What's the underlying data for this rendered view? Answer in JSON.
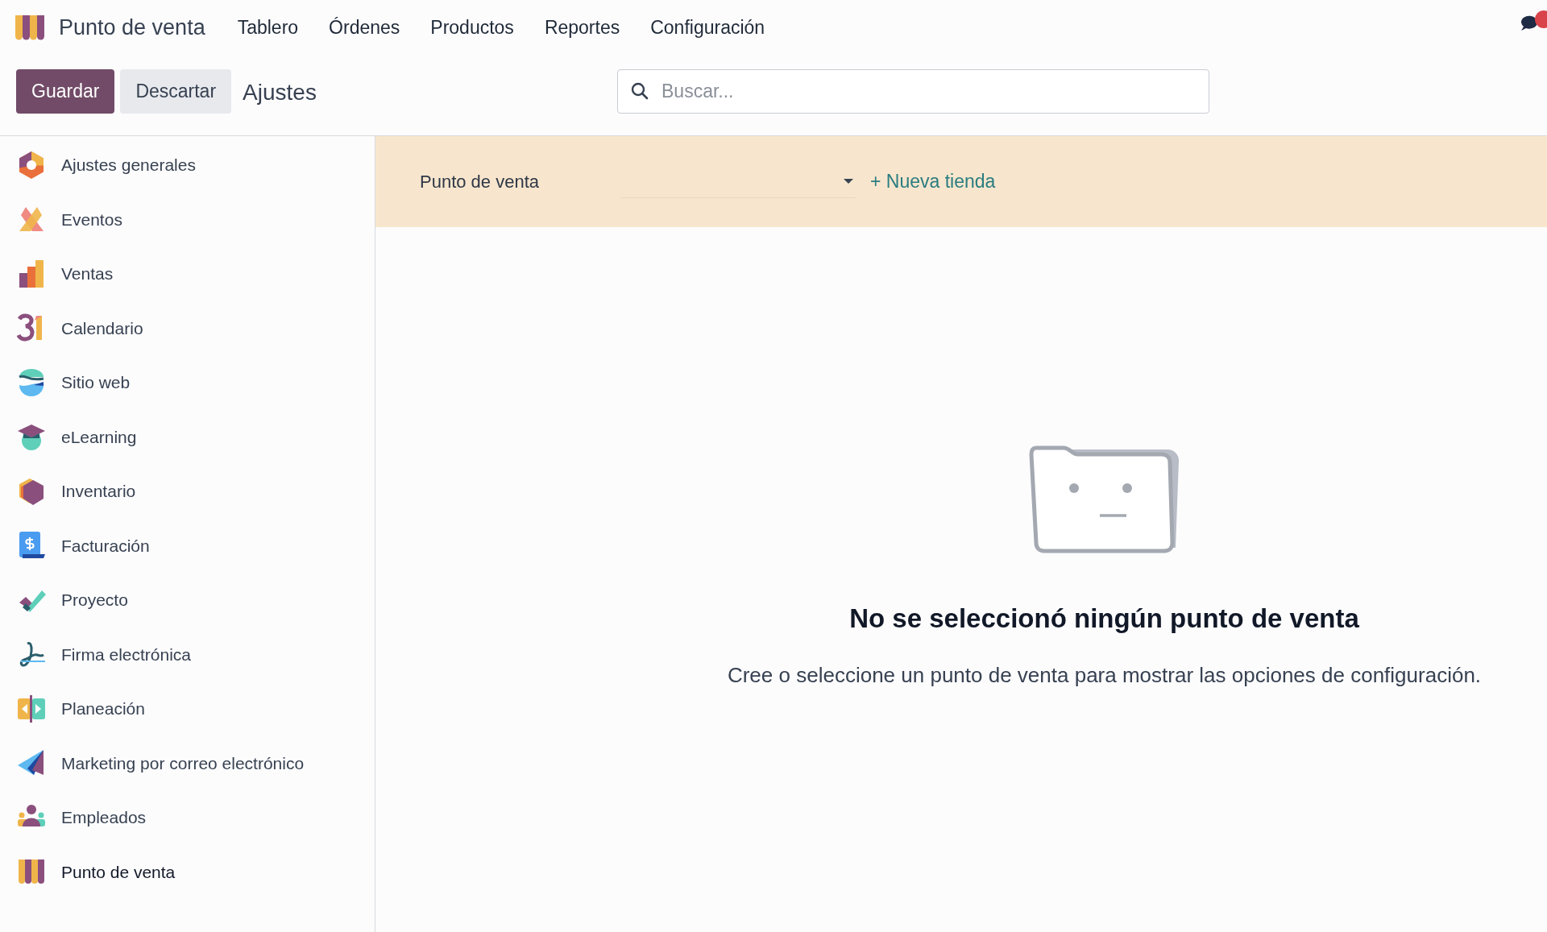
{
  "navbar": {
    "app_name": "Punto de venta",
    "menu": [
      "Tablero",
      "Órdenes",
      "Productos",
      "Reportes",
      "Configuración"
    ]
  },
  "control_panel": {
    "buttons": [
      {
        "label": "Guardar",
        "kind": "primary"
      },
      {
        "label": "Descartar",
        "kind": "secondary"
      }
    ],
    "breadcrumb": "Ajustes",
    "search": {
      "placeholder": "Buscar..."
    }
  },
  "sidebar": {
    "items": [
      {
        "label": "Ajustes generales",
        "selected": false
      },
      {
        "label": "Eventos",
        "selected": false
      },
      {
        "label": "Ventas",
        "selected": false
      },
      {
        "label": "Calendario",
        "selected": false
      },
      {
        "label": "Sitio web",
        "selected": false
      },
      {
        "label": "eLearning",
        "selected": false
      },
      {
        "label": "Inventario",
        "selected": false
      },
      {
        "label": "Facturación",
        "selected": false
      },
      {
        "label": "Proyecto",
        "selected": false
      },
      {
        "label": "Firma electrónica",
        "selected": false
      },
      {
        "label": "Planeación",
        "selected": false
      },
      {
        "label": "Marketing por correo electrónico",
        "selected": false
      },
      {
        "label": "Empleados",
        "selected": false
      },
      {
        "label": "Punto de venta",
        "selected": true
      }
    ]
  },
  "banner": {
    "label": "Punto de venta",
    "new_link": "+ Nueva tienda"
  },
  "empty_state": {
    "title": "No se seleccionó ningún punto de venta",
    "message": "Cree o seleccione un punto de venta para mostrar las opciones de configuración."
  }
}
